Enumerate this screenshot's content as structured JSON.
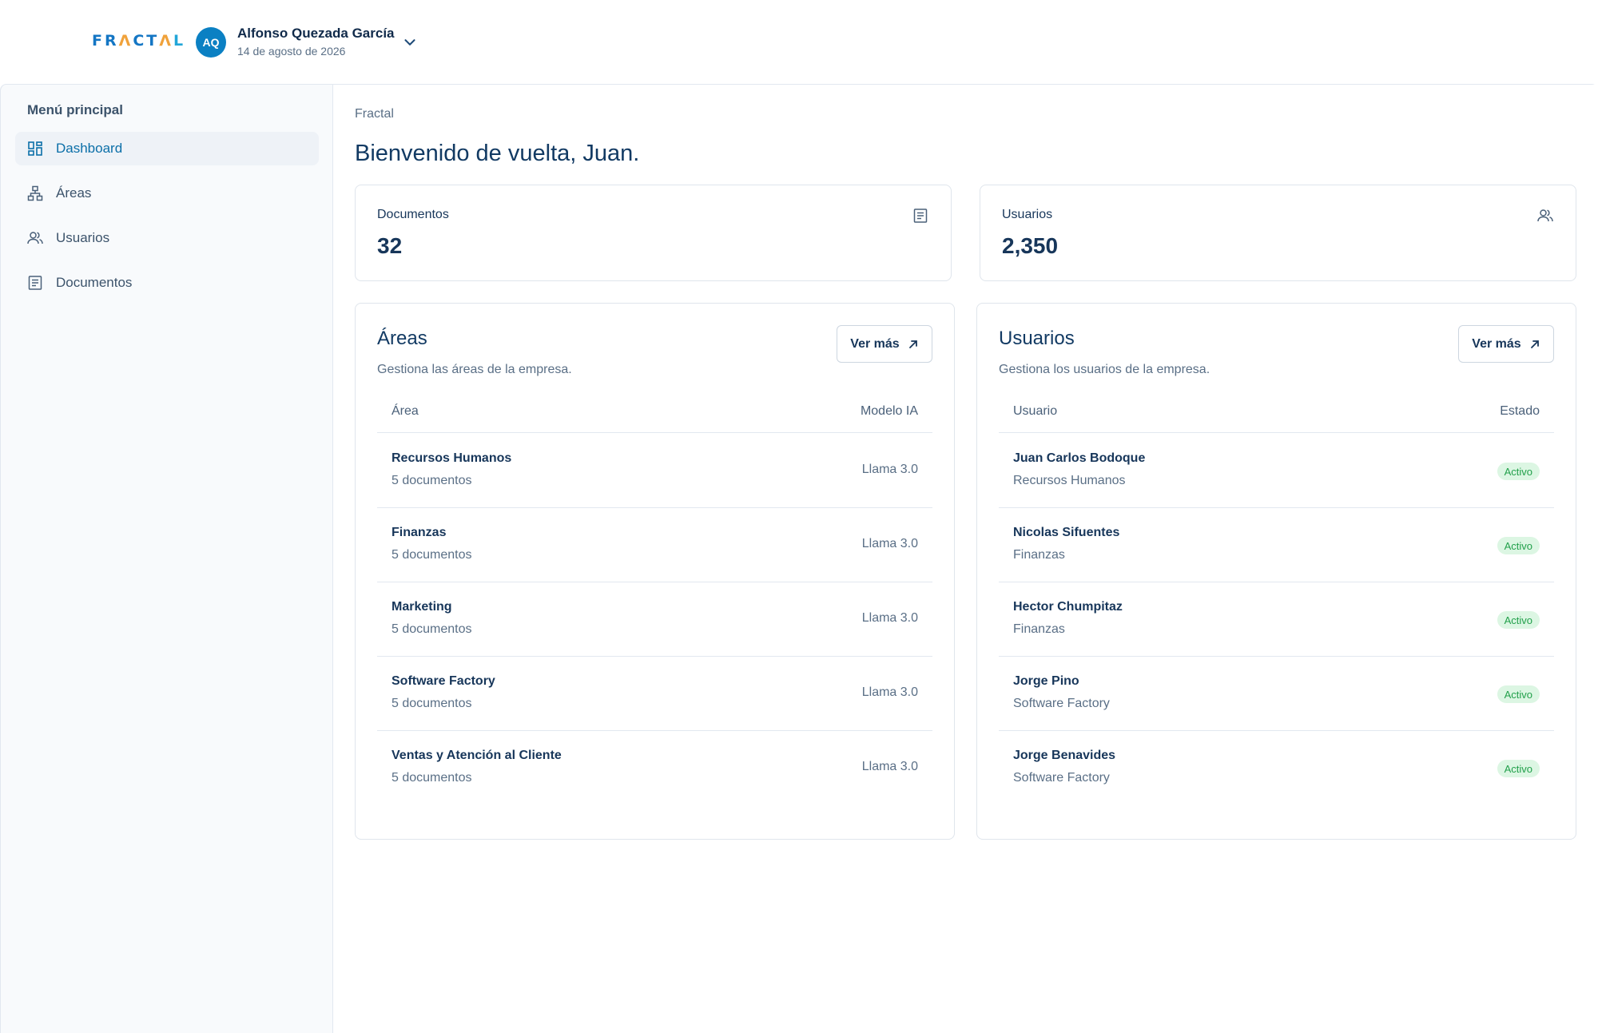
{
  "brand": {
    "logo_part1": "FR",
    "logo_part2": "Λ",
    "logo_part3": "CT",
    "logo_part4": "Λ",
    "logo_part5": "L",
    "colors": {
      "primary": "#1476c4",
      "accent": "#f0a23b",
      "text": "#14365a"
    }
  },
  "user": {
    "initials": "AQ",
    "name": "Alfonso Quezada García",
    "date": "14 de agosto de 2026",
    "menu_icon": "chevron-down-icon"
  },
  "sidebar": {
    "title": "Menú principal",
    "items": [
      {
        "label": "Dashboard",
        "icon": "dashboard-icon",
        "active": true
      },
      {
        "label": "Áreas",
        "icon": "sitemap-icon",
        "active": false
      },
      {
        "label": "Usuarios",
        "icon": "users-icon",
        "active": false
      },
      {
        "label": "Documentos",
        "icon": "document-icon",
        "active": false
      }
    ]
  },
  "main": {
    "breadcrumb": "Fractal",
    "title": "Bienvenido de vuelta, Juan.",
    "stats": [
      {
        "label": "Documentos",
        "value": "32",
        "icon": "document-icon"
      },
      {
        "label": "Usuarios",
        "value": "2,350",
        "icon": "users-icon"
      }
    ],
    "areas_panel": {
      "title": "Áreas",
      "subtitle": "Gestiona las áreas de la empresa.",
      "button": "Ver más",
      "col_left": "Área",
      "col_right": "Modelo IA",
      "rows": [
        {
          "name": "Recursos Humanos",
          "sub": "5 documentos",
          "value": "Llama 3.0"
        },
        {
          "name": "Finanzas",
          "sub": "5 documentos",
          "value": "Llama 3.0"
        },
        {
          "name": "Marketing",
          "sub": "5 documentos",
          "value": "Llama 3.0"
        },
        {
          "name": "Software Factory",
          "sub": "5 documentos",
          "value": "Llama 3.0"
        },
        {
          "name": "Ventas y Atención al Cliente",
          "sub": "5 documentos",
          "value": "Llama 3.0"
        }
      ]
    },
    "users_panel": {
      "title": "Usuarios",
      "subtitle": "Gestiona los usuarios de la empresa.",
      "button": "Ver más",
      "col_left": "Usuario",
      "col_right": "Estado",
      "rows": [
        {
          "name": "Juan Carlos Bodoque",
          "sub": "Recursos Humanos",
          "status": "Activo"
        },
        {
          "name": "Nicolas Sifuentes",
          "sub": "Finanzas",
          "status": "Activo"
        },
        {
          "name": "Hector Chumpitaz",
          "sub": "Finanzas",
          "status": "Activo"
        },
        {
          "name": "Jorge Pino",
          "sub": "Software Factory",
          "status": "Activo"
        },
        {
          "name": "Jorge Benavides",
          "sub": "Software Factory",
          "status": "Activo"
        }
      ]
    }
  }
}
